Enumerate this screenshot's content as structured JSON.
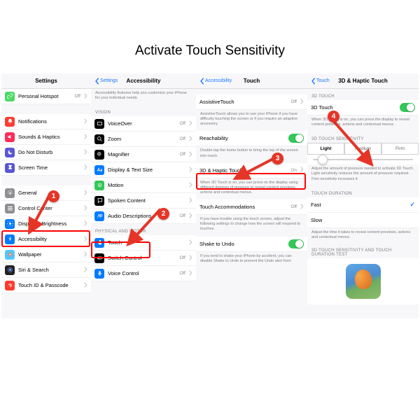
{
  "title": "Activate Touch Sensitivity",
  "badges": {
    "b1": "1",
    "b2": "2",
    "b3": "3",
    "b4": "4"
  },
  "col1": {
    "header": "Settings",
    "rows": {
      "hotspot": {
        "label": "Personal Hotspot",
        "value": "Off"
      },
      "notif": {
        "label": "Notifications"
      },
      "sounds": {
        "label": "Sounds & Haptics"
      },
      "dnd": {
        "label": "Do Not Disturb"
      },
      "screentime": {
        "label": "Screen Time"
      },
      "general": {
        "label": "General"
      },
      "control": {
        "label": "Control Center"
      },
      "display": {
        "label": "Display & Brightness"
      },
      "access": {
        "label": "Accessibility"
      },
      "wallpaper": {
        "label": "Wallpaper"
      },
      "siri": {
        "label": "Siri & Search"
      },
      "touchid": {
        "label": "Touch ID & Passcode"
      }
    }
  },
  "col2": {
    "back": "Settings",
    "title": "Accessibility",
    "intro": "Accessibility features help you customize your iPhone for your individual needs.",
    "sec1": "VISION",
    "rows": {
      "voiceover": {
        "label": "VoiceOver",
        "value": "Off"
      },
      "zoom": {
        "label": "Zoom",
        "value": "Off"
      },
      "magnifier": {
        "label": "Magnifier",
        "value": "Off"
      },
      "textsize": {
        "label": "Display & Text Size"
      },
      "motion": {
        "label": "Motion"
      },
      "spoken": {
        "label": "Spoken Content"
      },
      "audiodesc": {
        "label": "Audio Descriptions",
        "value": "Off"
      }
    },
    "sec2": "PHYSICAL AND MOTOR",
    "rows2": {
      "touch": {
        "label": "Touch"
      },
      "switch": {
        "label": "Switch Control",
        "value": "Off"
      },
      "voice": {
        "label": "Voice Control",
        "value": "Off"
      }
    }
  },
  "col3": {
    "back": "Accessibility",
    "title": "Touch",
    "rows": {
      "assist": {
        "label": "AssistiveTouch",
        "value": "Off"
      },
      "assistNote": "AssistiveTouch allows you to use your iPhone if you have difficulty touching the screen or if you require an adaptive accessory.",
      "reach": {
        "label": "Reachability"
      },
      "reachNote": "Double-tap the home button to bring the top of the screen into reach.",
      "haptic": {
        "label": "3D & Haptic Touch",
        "value": "On"
      },
      "hapticNote": "When 3D Touch is on, you can press on the display using different degrees of pressure to reveal content previews, actions and contextual menus.",
      "accom": {
        "label": "Touch Accommodations",
        "value": "Off"
      },
      "accomNote": "If you have trouble using the touch screen, adjust the following settings to change how the screen will respond to touches.",
      "shake": {
        "label": "Shake to Undo"
      },
      "shakeNote": "If you tend to shake your iPhone by accident, you can disable Shake to Undo to prevent the Undo alert from"
    }
  },
  "col4": {
    "back": "Touch",
    "title": "3D & Haptic Touch",
    "sec1": "3D TOUCH",
    "tdlabel": "3D Touch",
    "tdnote": "When 3D Touch is on, you can press the display to reveal content previews, actions and contextual menus.",
    "sec2": "3D TOUCH SENSITIVITY",
    "seg": {
      "light": "Light",
      "medium": "Medium",
      "firm": "Firm"
    },
    "sensNote": "Adjust the amount of pressure needed to activate 3D Touch. Light sensitivity reduces the amount of pressure required. Firm sensitivity increases it.",
    "sec3": "TOUCH DURATION",
    "fast": "Fast",
    "slow": "Slow",
    "durNote": "Adjust the time it takes to reveal content previews, actions and contextual menus.",
    "sec4": "3D TOUCH SENSITIVITY AND TOUCH DURATION TEST"
  }
}
